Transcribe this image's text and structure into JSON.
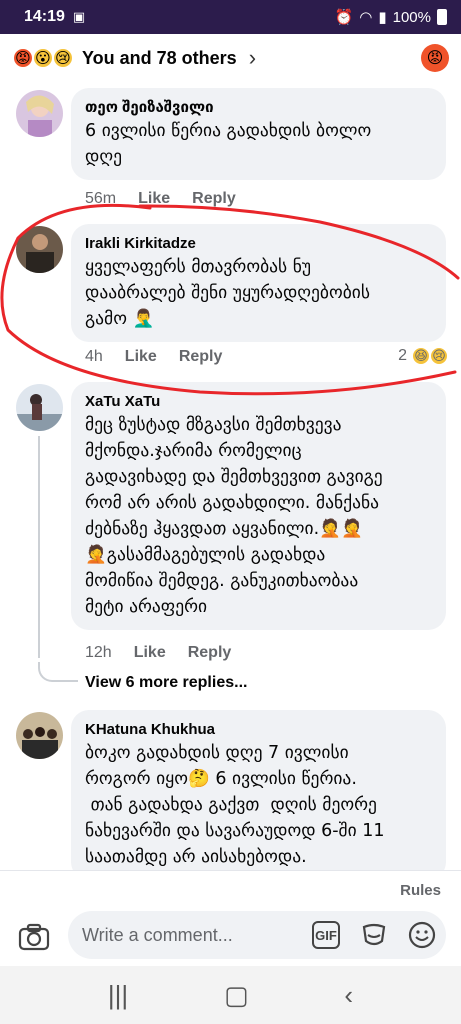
{
  "status": {
    "time": "14:19",
    "battery": "100%"
  },
  "reactions_header": {
    "summary": "You and 78 others"
  },
  "comments": [
    {
      "author": "თეო შეიზაშვილი",
      "text_lines": [
        "6 ივლისი წერია გადახდის ბოლო",
        "დღე"
      ],
      "time": "56m",
      "like": "Like",
      "reply": "Reply"
    },
    {
      "author": "Irakli Kirkitadze",
      "text_lines": [
        "ყველაფერს მთავრობას ნუ",
        "დააბრალებ შენი უყურადღებობის",
        "გამო 🤦‍♂️"
      ],
      "time": "4h",
      "like": "Like",
      "reply": "Reply",
      "reaction_count": "2"
    },
    {
      "author": "XaTu XaTu",
      "text_lines": [
        "მეც ზუსტად მზგავსი შემთხვევა",
        "მქონდა.ჯარიმა რომელიც",
        "გადავიხადე და შემთხვევით გავიგე",
        "რომ არ არის გადახდილი. მანქანა",
        "ძებნაზე ჰყავდათ აყვანილი.🤦🤦",
        "🤦გასამმაგებულის გადახდა",
        "მომიწია შემდეგ. განუკითხაობაა",
        "მეტი არაფერი"
      ],
      "time": "12h",
      "like": "Like",
      "reply": "Reply",
      "view_more": "View 6 more replies..."
    },
    {
      "author": "KHatuna Khukhua",
      "text_lines": [
        "ბოკო გადახდის დღე 7 ივლისი",
        "როგორ იყო🤔 6 ივლისი წერია.",
        " თან გადახდა გაქვთ  დღის მეორე",
        "ნახევარში და სავარაუდოდ 6-ში 11",
        "საათამდე არ აისახებოდა."
      ]
    }
  ],
  "composer": {
    "rules": "Rules",
    "placeholder": "Write a comment...",
    "gif": "GIF"
  },
  "colors": {
    "status_bar": "#2c1c4c",
    "bubble": "#f0f2f5",
    "scribble": "#e8262a"
  }
}
